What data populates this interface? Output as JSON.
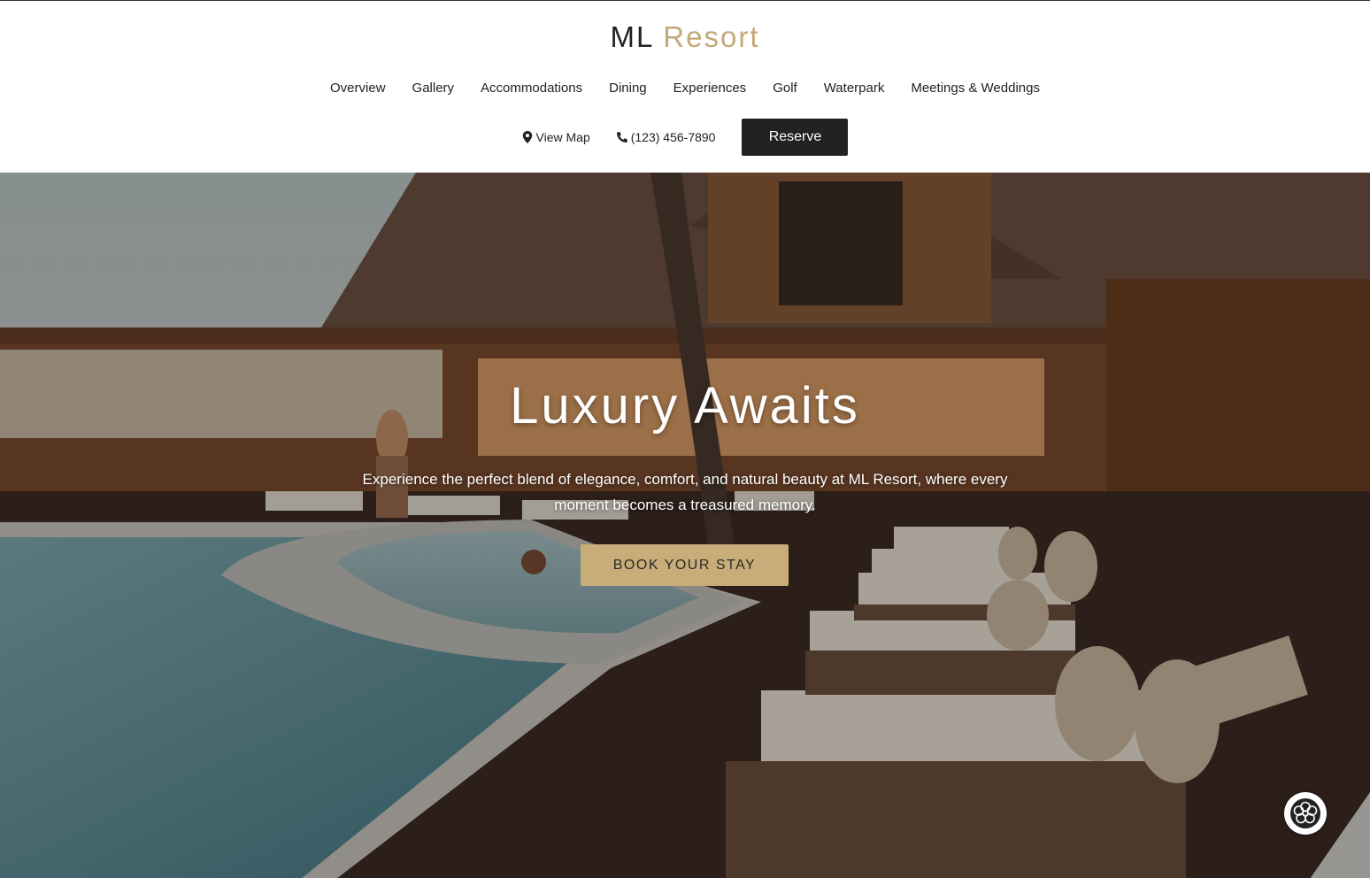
{
  "brand": {
    "name_part1": "ML",
    "name_part2": "Resort"
  },
  "nav": {
    "items": [
      {
        "label": "Overview"
      },
      {
        "label": "Gallery"
      },
      {
        "label": "Accommodations"
      },
      {
        "label": "Dining"
      },
      {
        "label": "Experiences"
      },
      {
        "label": "Golf"
      },
      {
        "label": "Waterpark"
      },
      {
        "label": "Meetings & Weddings"
      }
    ]
  },
  "actions": {
    "map_label": "View Map",
    "phone_label": "(123) 456-7890",
    "reserve_label": "Reserve",
    "map_icon": "map-marker-icon",
    "phone_icon": "phone-icon"
  },
  "hero": {
    "title": "Luxury Awaits",
    "subtitle": "Experience the perfect blend of elegance, comfort, and natural beauty at ML Resort, where every moment becomes a treasured memory.",
    "cta_label": "BOOK YOUR STAY"
  },
  "chat_widget": {
    "icon": "flower-badge-icon"
  },
  "colors": {
    "accent_gold": "#c4a877",
    "button_gold": "#c8ad78",
    "dark": "#222222"
  }
}
